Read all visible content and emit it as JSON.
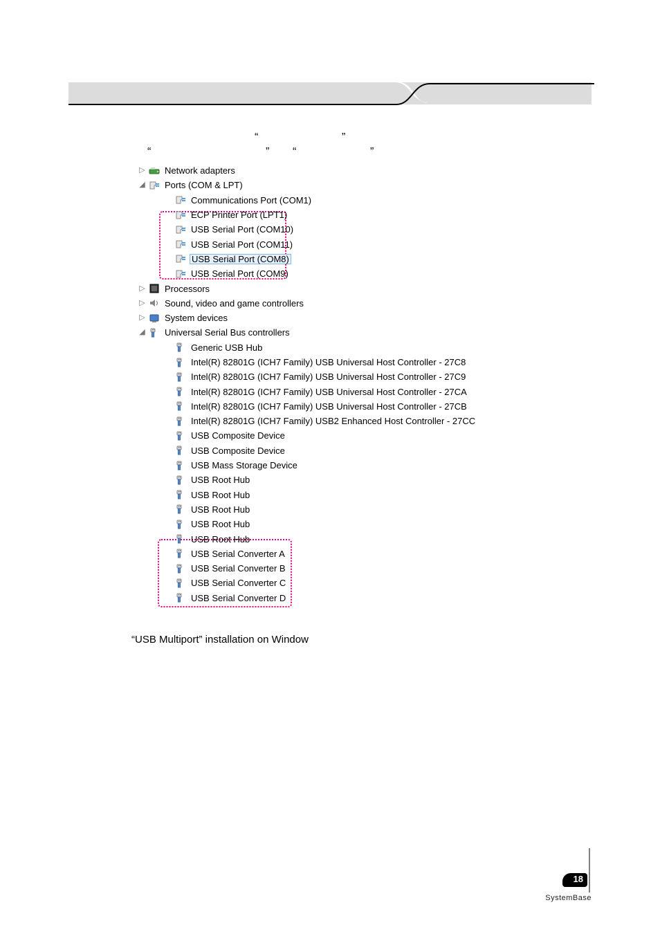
{
  "header": {},
  "instruction_quotes": [
    "“",
    "”",
    "“",
    "”",
    "“",
    "”"
  ],
  "tree": {
    "network_adapters": "Network adapters",
    "ports_com_lpt": "Ports (COM & LPT)",
    "comm_port_com1": "Communications Port (COM1)",
    "ecp_printer_lpt1": "ECP Printer Port (LPT1)",
    "usb_serial_port_com10": "USB Serial Port (COM10)",
    "usb_serial_port_com11": "USB Serial Port (COM11)",
    "usb_serial_port_com8": "USB Serial Port (COM8)",
    "usb_serial_port_com9": "USB Serial Port (COM9)",
    "processors": "Processors",
    "sound_video_game": "Sound, video and game controllers",
    "system_devices": "System devices",
    "usb_controllers": "Universal Serial Bus controllers",
    "generic_usb_hub": "Generic USB Hub",
    "intel_usb_27c8": "Intel(R) 82801G (ICH7 Family) USB Universal Host Controller - 27C8",
    "intel_usb_27c9": "Intel(R) 82801G (ICH7 Family) USB Universal Host Controller - 27C9",
    "intel_usb_27ca": "Intel(R) 82801G (ICH7 Family) USB Universal Host Controller - 27CA",
    "intel_usb_27cb": "Intel(R) 82801G (ICH7 Family) USB Universal Host Controller - 27CB",
    "intel_usb2_27cc": "Intel(R) 82801G (ICH7 Family) USB2 Enhanced Host Controller - 27CC",
    "usb_composite_1": "USB Composite Device",
    "usb_composite_2": "USB Composite Device",
    "usb_mass_storage": "USB Mass Storage Device",
    "usb_root_hub_1": "USB Root Hub",
    "usb_root_hub_2": "USB Root Hub",
    "usb_root_hub_3": "USB Root Hub",
    "usb_root_hub_4": "USB Root Hub",
    "usb_root_hub_5": "USB Root Hub",
    "usb_serial_conv_a": "USB Serial Converter A",
    "usb_serial_conv_b": "USB Serial Converter B",
    "usb_serial_conv_c": "USB Serial Converter C",
    "usb_serial_conv_d": "USB Serial Converter D"
  },
  "caption": "“USB Multiport” installation on Window",
  "page_number": "18",
  "footer_brand": "SystemBase"
}
